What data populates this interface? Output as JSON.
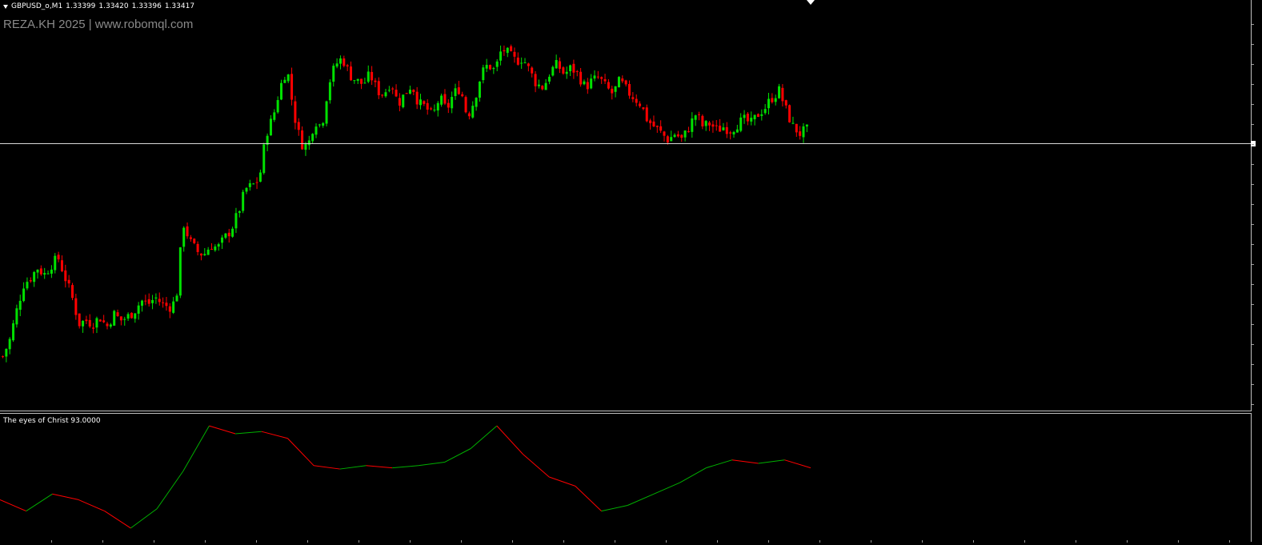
{
  "symbol": {
    "name_timeframe": "GBPUSD_o,M1",
    "open": "1.33399",
    "high": "1.33420",
    "low": "1.33396",
    "close": "1.33417"
  },
  "watermark": "REZA.KH 2025 | www.robomql.com",
  "indicator": {
    "label": "The eyes of Christ 93.0000",
    "up_color": "#00b000",
    "down_color": "#ff0000"
  },
  "colors": {
    "bull": "#00e000",
    "bear": "#ff0000",
    "background": "#000000",
    "price_line": "#d8d8d8"
  },
  "chart_data": {
    "type": "candlestick",
    "series": [
      {
        "name": "GBPUSD_o,M1",
        "close_path": [
          0.06,
          0.11,
          0.2,
          0.28,
          0.3,
          0.33,
          0.31,
          0.34,
          0.36,
          0.3,
          0.24,
          0.16,
          0.17,
          0.16,
          0.18,
          0.15,
          0.19,
          0.17,
          0.18,
          0.2,
          0.23,
          0.22,
          0.24,
          0.22,
          0.21,
          0.23,
          0.47,
          0.41,
          0.38,
          0.37,
          0.4,
          0.39,
          0.42,
          0.45,
          0.5,
          0.57,
          0.58,
          0.6,
          0.74,
          0.79,
          0.88,
          0.94,
          0.8,
          0.71,
          0.7,
          0.78,
          0.76,
          0.89,
          0.95,
          0.97,
          0.92,
          0.9,
          0.89,
          0.92,
          0.87,
          0.86,
          0.9,
          0.83,
          0.86,
          0.89,
          0.83,
          0.82,
          0.79,
          0.85,
          0.81,
          0.86,
          0.88,
          0.79,
          0.84,
          0.92,
          0.95,
          0.93,
          1.0,
          0.98,
          0.96,
          0.97,
          0.93,
          0.89,
          0.88,
          0.93,
          0.95,
          0.92,
          0.94,
          0.92,
          0.88,
          0.9,
          0.91,
          0.88,
          0.86,
          0.9,
          0.87,
          0.85,
          0.83,
          0.78,
          0.76,
          0.74,
          0.72,
          0.74,
          0.72,
          0.76,
          0.8,
          0.76,
          0.77,
          0.75,
          0.76,
          0.75,
          0.77,
          0.78,
          0.77,
          0.8,
          0.82,
          0.85,
          0.87,
          0.81,
          0.76,
          0.74,
          0.75
        ]
      },
      {
        "name": "The eyes of Christ",
        "values": [
          0.3,
          0.2,
          0.35,
          0.3,
          0.2,
          0.05,
          0.22,
          0.55,
          0.95,
          0.88,
          0.9,
          0.84,
          0.6,
          0.57,
          0.6,
          0.58,
          0.6,
          0.63,
          0.75,
          0.95,
          0.7,
          0.5,
          0.42,
          0.2,
          0.25,
          0.35,
          0.45,
          0.58,
          0.65,
          0.62,
          0.65,
          0.58
        ]
      }
    ]
  }
}
